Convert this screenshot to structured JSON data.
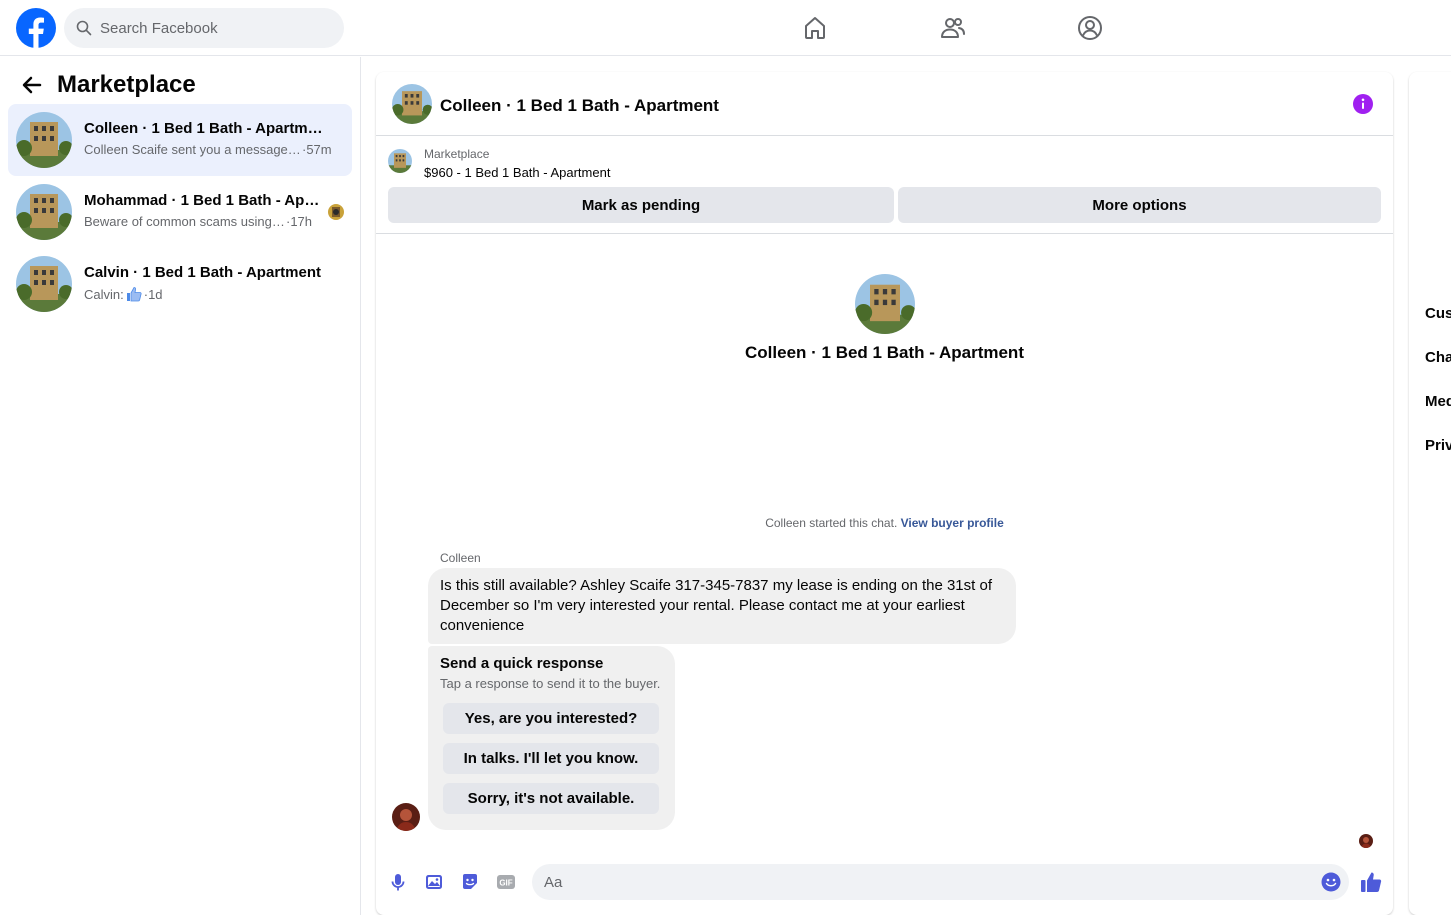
{
  "search": {
    "placeholder": "Search Facebook"
  },
  "nav_icons": [
    "home-icon",
    "friends-icon",
    "profile-icon"
  ],
  "sidebar": {
    "title": "Marketplace",
    "conversations": [
      {
        "title": "Colleen · 1 Bed 1 Bath - Apartment",
        "snippet": "Colleen Scaife sent you a message a...",
        "time": "·57m",
        "active": true
      },
      {
        "title": "Mohammad · 1 Bed 1 Bath - Apa...",
        "snippet": "Beware of common scams using ...",
        "time": "·17h",
        "active": false
      },
      {
        "title": "Calvin · 1 Bed 1 Bath - Apartment",
        "snippet": "Calvin:",
        "time": "·1d",
        "active": false
      }
    ]
  },
  "chat": {
    "header_title": "Colleen · 1 Bed 1 Bath - Apartment",
    "listing": {
      "label": "Marketplace",
      "price_title": "$960 - 1 Bed 1 Bath - Apartment"
    },
    "buttons": {
      "pending": "Mark as pending",
      "more": "More options"
    },
    "intro_title": "Colleen · 1 Bed 1 Bath - Apartment",
    "started_text": "Colleen started this chat.",
    "view_profile": "View buyer profile",
    "sender": "Colleen",
    "message": "Is this still available? Ashley Scaife 317-345-7837 my lease is ending on the 31st of December so I'm very interested your rental. Please contact me at your earliest convenience",
    "quick_response": {
      "title": "Send a quick response",
      "subtitle": "Tap a response to send it to the buyer.",
      "options": [
        "Yes, are you interested?",
        "In talks. I'll let you know.",
        "Sorry, it's not available."
      ]
    },
    "composer_placeholder": "Aa"
  },
  "right_panel": {
    "items": [
      "Cust",
      "Cha",
      "Med",
      "Priv"
    ]
  },
  "colors": {
    "accent": "#0866ff",
    "messenger_blue": "#4e5bd9",
    "info_purple": "#a020f0"
  }
}
